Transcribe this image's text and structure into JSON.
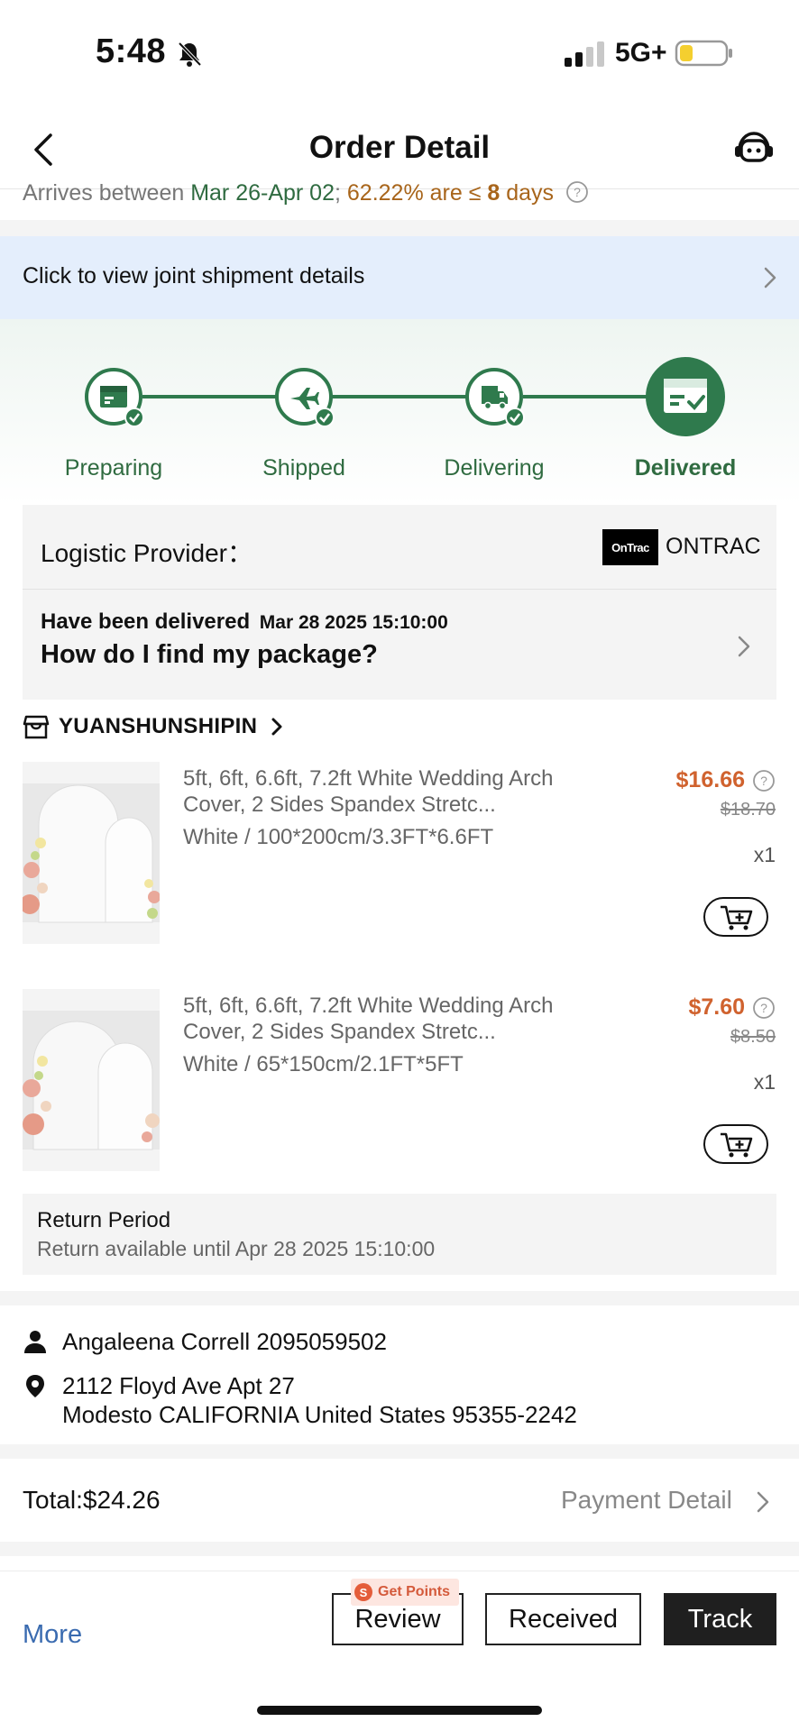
{
  "status_bar": {
    "time": "5:48",
    "network": "5G+"
  },
  "nav": {
    "title": "Order Detail"
  },
  "arrival": {
    "prefix": "Arrives between ",
    "dates": "Mar 26-Apr 02",
    "separator": ";",
    "rate": " 62.22% are ≤ ",
    "days_num": "8",
    "days_word": " days"
  },
  "joint_shipment": {
    "text": "Click to view joint shipment details"
  },
  "progress": {
    "steps": [
      {
        "label": "Preparing",
        "icon": "box-icon"
      },
      {
        "label": "Shipped",
        "icon": "plane-icon"
      },
      {
        "label": "Delivering",
        "icon": "truck-icon"
      },
      {
        "label": "Delivered",
        "icon": "delivered-icon"
      }
    ],
    "active_step": 4,
    "accent_color": "#2f7a4d"
  },
  "logistics": {
    "label": "Logistic Provider：",
    "logo_text": "OnTrac",
    "provider": "ONTRAC",
    "status": "Have been delivered",
    "status_date": "Mar 28 2025 15:10:00",
    "find_package": "How do I find my package?"
  },
  "shop": {
    "name": "YUANSHUNSHIPIN"
  },
  "products": [
    {
      "title": "5ft, 6ft, 6.6ft, 7.2ft White Wedding Arch Cover, 2 Sides Spandex Stretc...",
      "variant": "White / 100*200cm/3.3FT*6.6FT",
      "price": "$16.66",
      "original_price": "$18.70",
      "quantity": "x1"
    },
    {
      "title": "5ft, 6ft, 6.6ft, 7.2ft White Wedding Arch Cover, 2 Sides Spandex Stretc...",
      "variant": "White / 65*150cm/2.1FT*5FT",
      "price": "$7.60",
      "original_price": "$8.50",
      "quantity": "x1"
    }
  ],
  "return_period": {
    "title": "Return Period",
    "subtitle": "Return available until Apr 28 2025 15:10:00"
  },
  "address": {
    "contact": "Angaleena Correll 2095059502",
    "line1": "2112 Floyd Ave Apt 27",
    "line2": "Modesto CALIFORNIA United States 95355-2242"
  },
  "summary": {
    "total": "Total:$24.26",
    "payment_detail": "Payment Detail"
  },
  "actions": {
    "more": "More",
    "points_badge": "Get Points",
    "points_coin": "S",
    "review": "Review",
    "received": "Received",
    "track": "Track"
  },
  "colors": {
    "accent_green": "#2f7a4d",
    "price_orange": "#d0622e",
    "link_blue": "#3a6bb0",
    "banner_blue": "#e4eefc"
  }
}
